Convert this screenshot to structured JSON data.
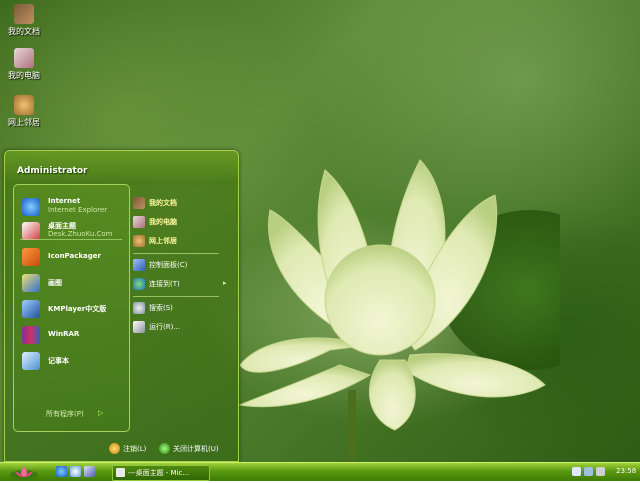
{
  "desktop": {
    "icons": [
      {
        "label": "我的文档",
        "icon": "my-documents-icon"
      },
      {
        "label": "我的电脑",
        "icon": "my-computer-icon"
      },
      {
        "label": "网上邻居",
        "icon": "network-places-icon"
      }
    ]
  },
  "start_menu": {
    "user": "Administrator",
    "left_items": [
      {
        "title": "Internet",
        "subtitle": "Internet Explorer",
        "icon": "internet-explorer-icon"
      },
      {
        "title": "桌面主题",
        "subtitle": "Desk.ZhuoKu.Com",
        "icon": "desk-theme-icon"
      },
      {
        "title": "IconPackager",
        "subtitle": "",
        "icon": "iconpackager-icon"
      },
      {
        "title": "画图",
        "subtitle": "",
        "icon": "paint-icon"
      },
      {
        "title": "KMPlayer中文版",
        "subtitle": "",
        "icon": "kmplayer-icon"
      },
      {
        "title": "WinRAR",
        "subtitle": "",
        "icon": "winrar-icon"
      },
      {
        "title": "记事本",
        "subtitle": "",
        "icon": "notepad-icon"
      }
    ],
    "all_programs": "所有程序(P)",
    "all_programs_arrow": "▷",
    "right_items": [
      {
        "label": "我的文档",
        "icon": "my-documents-icon"
      },
      {
        "label": "我的电脑",
        "icon": "my-computer-icon"
      },
      {
        "label": "网上邻居",
        "icon": "network-places-icon"
      },
      {
        "label": "控制面板(C)",
        "icon": "control-panel-icon"
      },
      {
        "label": "连接到(T)",
        "icon": "connect-to-icon",
        "arrow": "▸"
      },
      {
        "label": "搜索(S)",
        "icon": "search-icon"
      },
      {
        "label": "运行(R)...",
        "icon": "run-icon"
      }
    ],
    "footer": {
      "logoff": "注销(L)",
      "shutdown": "关闭计算机(U)"
    }
  },
  "taskbar": {
    "window_title": "---桌面主题 - Mic...",
    "clock": "23:58",
    "colors": {
      "start": "#e05a8a",
      "bar": "#5a9a10"
    }
  }
}
